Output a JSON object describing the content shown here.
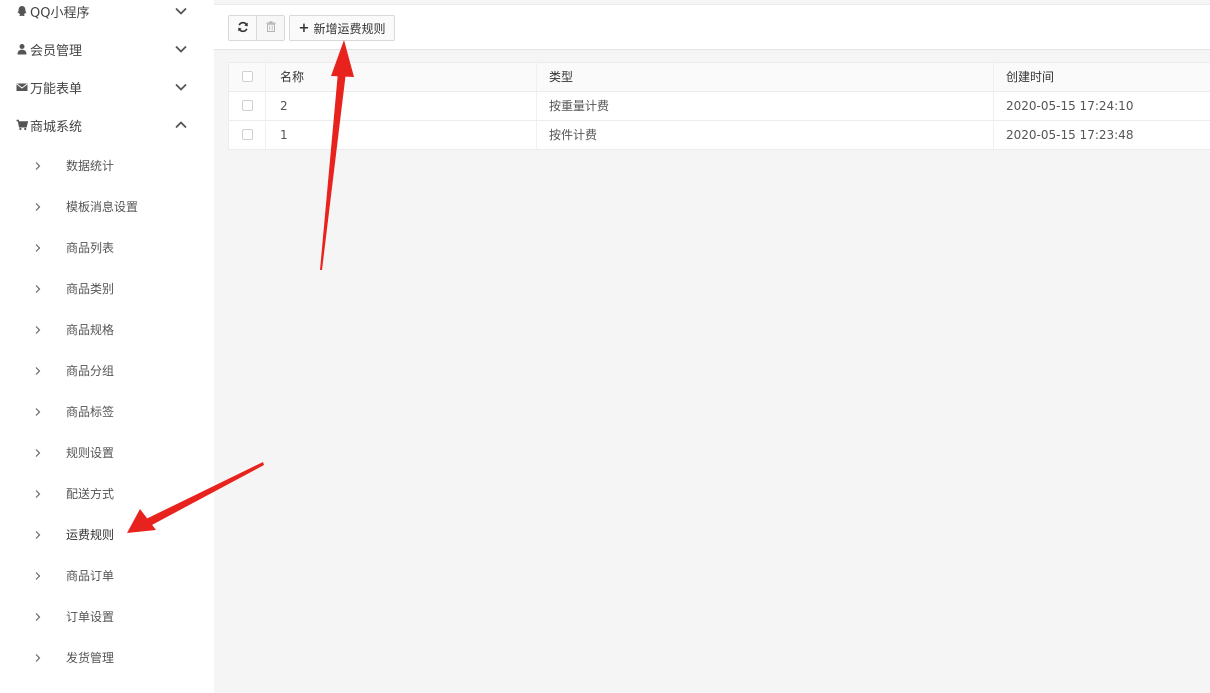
{
  "sidebar": {
    "top_menus": [
      {
        "label": "QQ小程序",
        "icon": "qq-icon",
        "expanded": false
      },
      {
        "label": "会员管理",
        "icon": "user-icon",
        "expanded": false
      },
      {
        "label": "万能表单",
        "icon": "envelope-icon",
        "expanded": false
      },
      {
        "label": "商城系统",
        "icon": "cart-icon",
        "expanded": true
      }
    ],
    "sub_items": [
      "数据统计",
      "模板消息设置",
      "商品列表",
      "商品类别",
      "商品规格",
      "商品分组",
      "商品标签",
      "规则设置",
      "配送方式",
      "运费规则",
      "商品订单",
      "订单设置",
      "发货管理"
    ],
    "active_sub_item": "运费规则"
  },
  "toolbar": {
    "refresh_icon": "refresh-icon",
    "delete_icon": "trash-icon",
    "add_label": "新增运费规则"
  },
  "table": {
    "headers": {
      "name": "名称",
      "type": "类型",
      "time": "创建时间"
    },
    "rows": [
      {
        "name": "2",
        "type": "按重量计费",
        "time": "2020-05-15 17:24:10"
      },
      {
        "name": "1",
        "type": "按件计费",
        "time": "2020-05-15 17:23:48"
      }
    ]
  },
  "colors": {
    "annotation": "#e8231e",
    "main_bg": "#f5f5f5",
    "sidebar_bg": "#ffffff"
  }
}
